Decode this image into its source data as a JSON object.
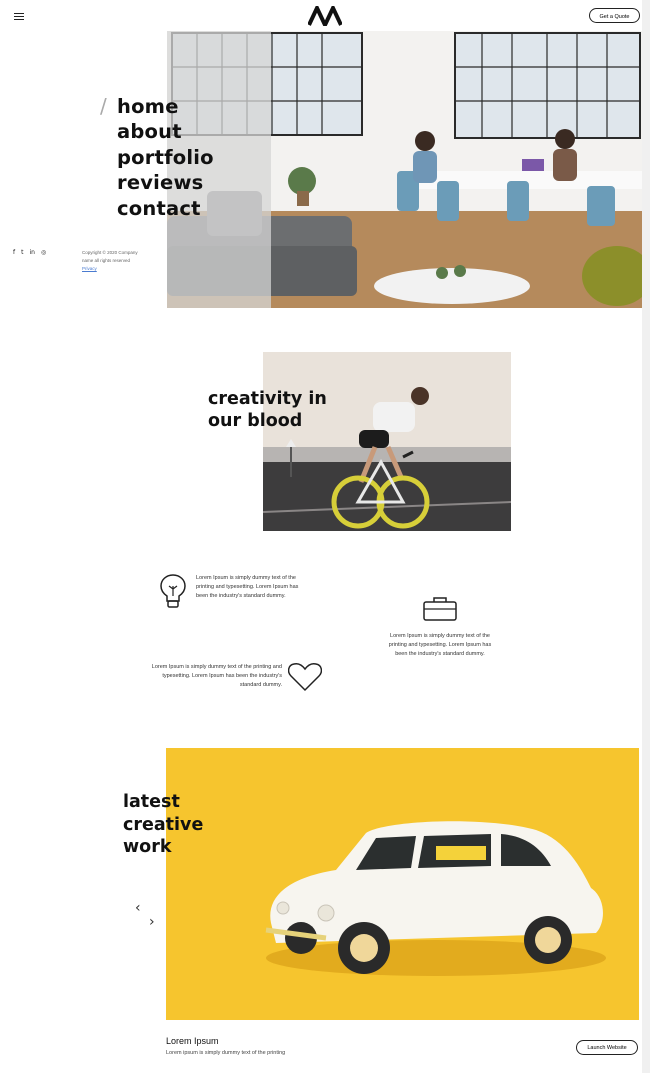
{
  "header": {
    "menu_icon": "hamburger-icon",
    "logo_icon": "brand-logo",
    "cta_label": "Get a Quote"
  },
  "nav": {
    "items": [
      {
        "label": "home"
      },
      {
        "label": "about"
      },
      {
        "label": "portfolio"
      },
      {
        "label": "reviews"
      },
      {
        "label": "contact"
      }
    ],
    "divider": "/"
  },
  "sidebar": {
    "social": [
      {
        "icon": "facebook-icon",
        "glyph": "f"
      },
      {
        "icon": "twitter-icon",
        "glyph": "t"
      },
      {
        "icon": "linkedin-icon",
        "glyph": "in"
      },
      {
        "icon": "instagram-icon",
        "glyph": "◎"
      }
    ],
    "copyright_line1": "Copyright © 2020 Company",
    "copyright_line2": "name all rights reserved",
    "copyright_link": "Privacy"
  },
  "about": {
    "headline_line1": "creativity in",
    "headline_line2": "our blood"
  },
  "features": [
    {
      "icon": "lightbulb-icon",
      "text": "Lorem Ipsum is simply dummy text of the printing and typesetting. Lorem Ipsum has been the industry's standard dummy."
    },
    {
      "icon": "briefcase-icon",
      "text": "Lorem Ipsum is simply dummy text of the printing and typesetting. Lorem Ipsum has been the industry's standard dummy."
    },
    {
      "icon": "heart-icon",
      "text": "Lorem Ipsum is simply dummy text of the printing and typesetting. Lorem Ipsum has been the industry's standard dummy."
    }
  ],
  "work": {
    "headline_line1": "latest",
    "headline_line2": "creative",
    "headline_line3": "work",
    "prev_icon": "chevron-left-icon",
    "next_icon": "chevron-right-icon",
    "project_title": "Lorem Ipsum",
    "project_desc": "Lorem ipsum is simply dummy text of the printing",
    "launch_label": "Launch Website"
  },
  "colors": {
    "accent_yellow": "#f6c52e",
    "text_dark": "#111111",
    "link_blue": "#4a7bd0"
  }
}
